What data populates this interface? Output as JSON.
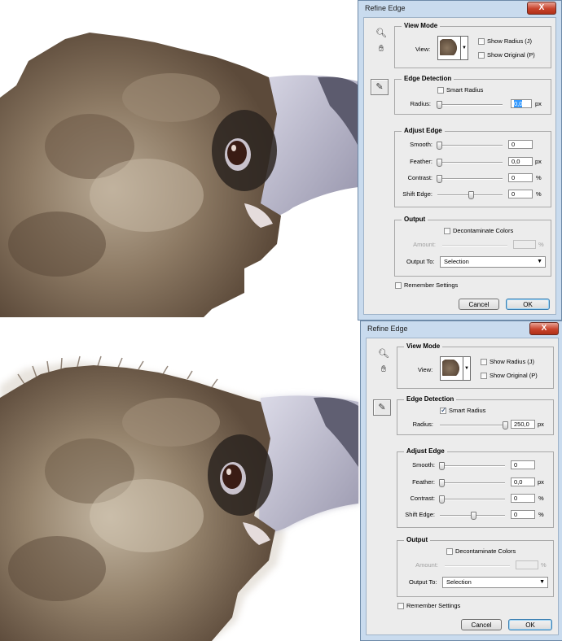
{
  "panels": [
    {
      "dialog": {
        "title": "Refine Edge",
        "close": "X",
        "view_mode": {
          "title": "View Mode",
          "view_label": "View:",
          "show_radius": {
            "label": "Show Radius (J)",
            "checked": false
          },
          "show_original": {
            "label": "Show Original (P)",
            "checked": false
          }
        },
        "edge_detection": {
          "title": "Edge Detection",
          "smart_radius": {
            "label": "Smart Radius",
            "checked": false
          },
          "radius_label": "Radius:",
          "radius_value": "0,0",
          "radius_unit": "px"
        },
        "adjust_edge": {
          "title": "Adjust Edge",
          "smooth_label": "Smooth:",
          "smooth_value": "0",
          "feather_label": "Feather:",
          "feather_value": "0,0",
          "feather_unit": "px",
          "contrast_label": "Contrast:",
          "contrast_value": "0",
          "contrast_unit": "%",
          "shift_label": "Shift Edge:",
          "shift_value": "0",
          "shift_unit": "%"
        },
        "output": {
          "title": "Output",
          "decontaminate": {
            "label": "Decontaminate Colors",
            "checked": false
          },
          "amount_label": "Amount:",
          "amount_unit": "%",
          "output_to_label": "Output To:",
          "output_to_value": "Selection"
        },
        "remember": {
          "label": "Remember Settings",
          "checked": false
        },
        "cancel": "Cancel",
        "ok": "OK"
      }
    },
    {
      "dialog": {
        "title": "Refine Edge",
        "close": "X",
        "view_mode": {
          "title": "View Mode",
          "view_label": "View:",
          "show_radius": {
            "label": "Show Radius (J)",
            "checked": false
          },
          "show_original": {
            "label": "Show Original (P)",
            "checked": false
          }
        },
        "edge_detection": {
          "title": "Edge Detection",
          "smart_radius": {
            "label": "Smart Radius",
            "checked": true
          },
          "radius_label": "Radius:",
          "radius_value": "250,0",
          "radius_unit": "px"
        },
        "adjust_edge": {
          "title": "Adjust Edge",
          "smooth_label": "Smooth:",
          "smooth_value": "0",
          "feather_label": "Feather:",
          "feather_value": "0,0",
          "feather_unit": "px",
          "contrast_label": "Contrast:",
          "contrast_value": "0",
          "contrast_unit": "%",
          "shift_label": "Shift Edge:",
          "shift_value": "0",
          "shift_unit": "%"
        },
        "output": {
          "title": "Output",
          "decontaminate": {
            "label": "Decontaminate Colors",
            "checked": false
          },
          "amount_label": "Amount:",
          "amount_unit": "%",
          "output_to_label": "Output To:",
          "output_to_value": "Selection"
        },
        "remember": {
          "label": "Remember Settings",
          "checked": false
        },
        "cancel": "Cancel",
        "ok": "OK"
      }
    }
  ],
  "icons": {
    "zoom": "zoom-tool-icon",
    "hand": "hand-tool-icon",
    "refine_radius": "refine-radius-tool-icon"
  },
  "colors": {
    "titlebar": "#c9dbee",
    "close_button": "#c8432c",
    "feather_brown": "#8a7660",
    "beak": "#b9b7c9"
  }
}
